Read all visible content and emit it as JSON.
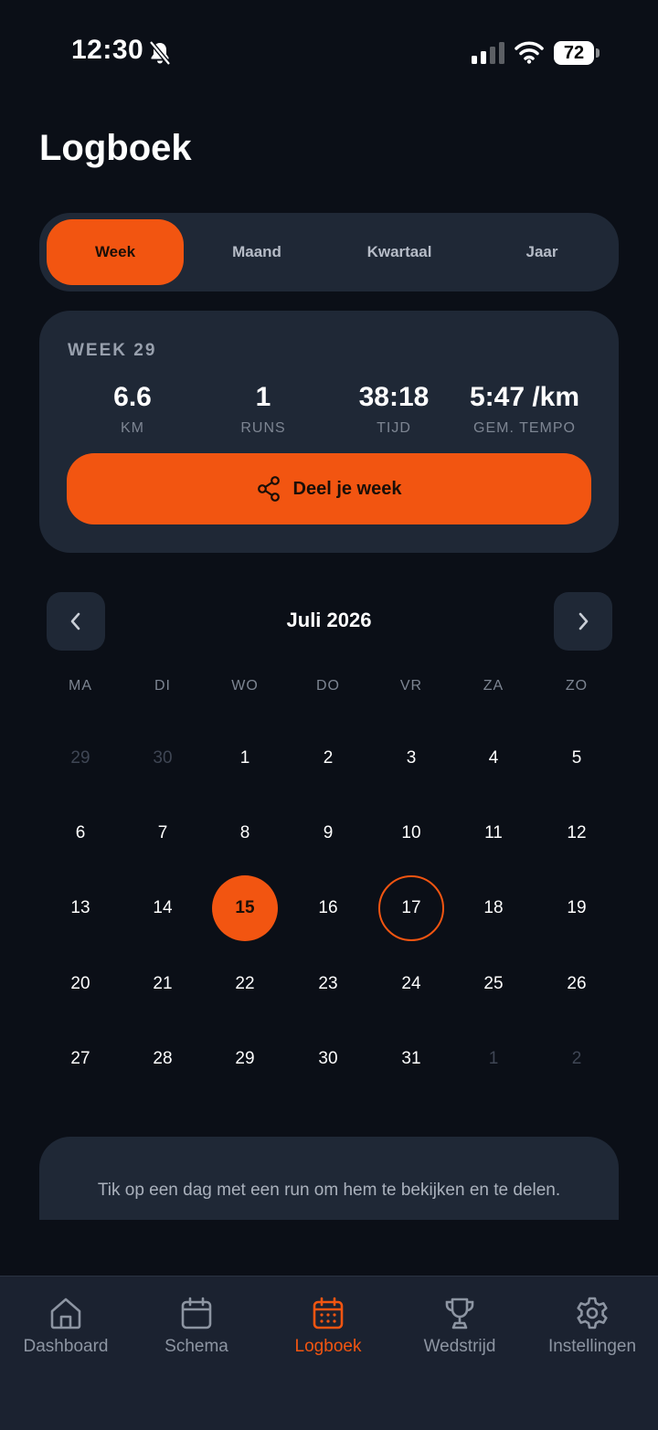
{
  "status": {
    "time": "12:30",
    "battery": "72"
  },
  "page": {
    "title": "Logboek"
  },
  "segments": [
    {
      "label": "Week",
      "active": true
    },
    {
      "label": "Maand",
      "active": false
    },
    {
      "label": "Kwartaal",
      "active": false
    },
    {
      "label": "Jaar",
      "active": false
    }
  ],
  "week_card": {
    "label": "WEEK 29",
    "stats": [
      {
        "value": "6.6",
        "label": "KM"
      },
      {
        "value": "1",
        "label": "RUNS"
      },
      {
        "value": "38:18",
        "label": "TIJD"
      },
      {
        "value": "5:47 /km",
        "label": "GEM. TEMPO"
      }
    ],
    "share_label": "Deel je week",
    "share_icon": "share-icon"
  },
  "calendar": {
    "month": "Juli 2026",
    "weekdays": [
      "MA",
      "DI",
      "WO",
      "DO",
      "VR",
      "ZA",
      "ZO"
    ],
    "weeks": [
      [
        "29",
        "30",
        "1",
        "2",
        "3",
        "4",
        "5"
      ],
      [
        "6",
        "7",
        "8",
        "9",
        "10",
        "11",
        "12"
      ],
      [
        "13",
        "14",
        "15",
        "16",
        "17",
        "18",
        "19"
      ],
      [
        "20",
        "21",
        "22",
        "23",
        "24",
        "25",
        "26"
      ],
      [
        "27",
        "28",
        "29",
        "30",
        "31",
        "1",
        "2"
      ]
    ],
    "selected_day": "15",
    "today": "17"
  },
  "hint": {
    "text": "Tik op een dag met een run om hem te bekijken en te delen."
  },
  "tabs": [
    {
      "label": "Dashboard",
      "icon": "home-icon",
      "active": false
    },
    {
      "label": "Schema",
      "icon": "calendar-icon",
      "active": false
    },
    {
      "label": "Logboek",
      "icon": "calendar-grid-icon",
      "active": true
    },
    {
      "label": "Wedstrijd",
      "icon": "trophy-icon",
      "active": false
    },
    {
      "label": "Instellingen",
      "icon": "gear-icon",
      "active": false
    }
  ],
  "colors": {
    "accent": "#f25511",
    "background": "#0b0f17",
    "card": "#1f2836",
    "muted_text": "#7d8592"
  }
}
